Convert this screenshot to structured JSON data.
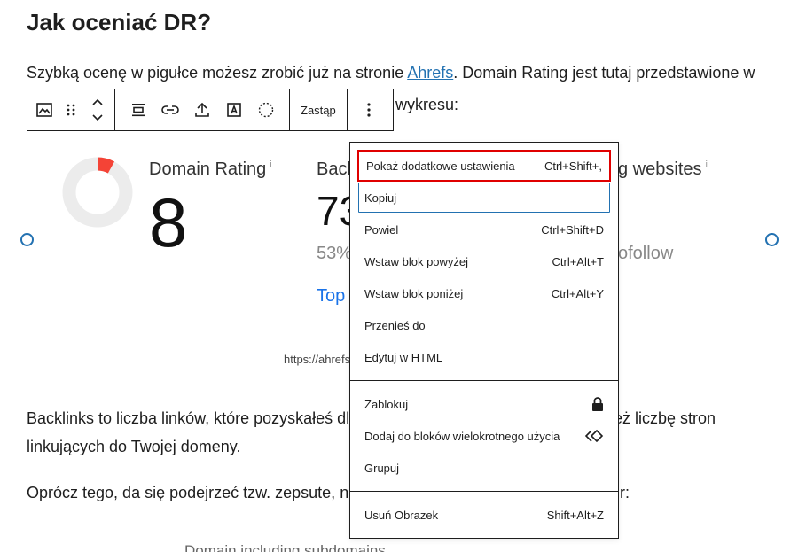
{
  "article": {
    "heading": "Jak oceniać DR?",
    "para1_before": "Szybką ocenę w pigułce możesz zrobić już na stronie ",
    "para1_link": "Ahrefs",
    "para1_after": ". Domain Rating jest tutaj przedstawione w",
    "para1_line2_visible": "wykresu:",
    "para2_line1_left": "Backlinks to liczba linków, które pozyskałeś  dl",
    "para2_line1_right": "eż liczbę stron",
    "para2_line2": "linkujących do Twojej domeny.",
    "para3_left": "Oprócz tego, da się podejrzeć tzw. zepsute, ni",
    "para3_right": "r:",
    "bottom_cut": "Domain including subdomains"
  },
  "toolbar": {
    "replace_label": "Zastąp"
  },
  "image": {
    "dr_label": "Domain Rating",
    "dr_value": "8",
    "dr_fraction": 0.08,
    "info": "i",
    "backlinks_label_partial": "Back",
    "backlinks_value_partial": "73",
    "backlinks_pct_partial": "53%",
    "top_link_partial": "Top",
    "referring_label_partial": "g websites",
    "nofollow_partial": "ofollow",
    "url_partial": "https://ahrefs",
    "colors": {
      "donut_fill": "#f44336",
      "donut_track": "#ececec",
      "accent": "#2271b1"
    }
  },
  "menu": {
    "sections": [
      [
        {
          "label": "Pokaż dodatkowe ustawienia",
          "shortcut": "Ctrl+Shift+,"
        },
        {
          "label": "Kopiuj",
          "shortcut": ""
        },
        {
          "label": "Powiel",
          "shortcut": "Ctrl+Shift+D"
        },
        {
          "label": "Wstaw blok powyżej",
          "shortcut": "Ctrl+Alt+T"
        },
        {
          "label": "Wstaw blok poniżej",
          "shortcut": "Ctrl+Alt+Y"
        },
        {
          "label": "Przenieś do",
          "shortcut": ""
        },
        {
          "label": "Edytuj w HTML",
          "shortcut": ""
        }
      ],
      [
        {
          "label": "Zablokuj",
          "icon": "lock-icon"
        },
        {
          "label": "Dodaj do bloków wielokrotnego użycia",
          "icon": "reusable-block-icon"
        },
        {
          "label": "Grupuj"
        }
      ],
      [
        {
          "label": "Usuń Obrazek",
          "shortcut": "Shift+Alt+Z"
        }
      ]
    ]
  }
}
